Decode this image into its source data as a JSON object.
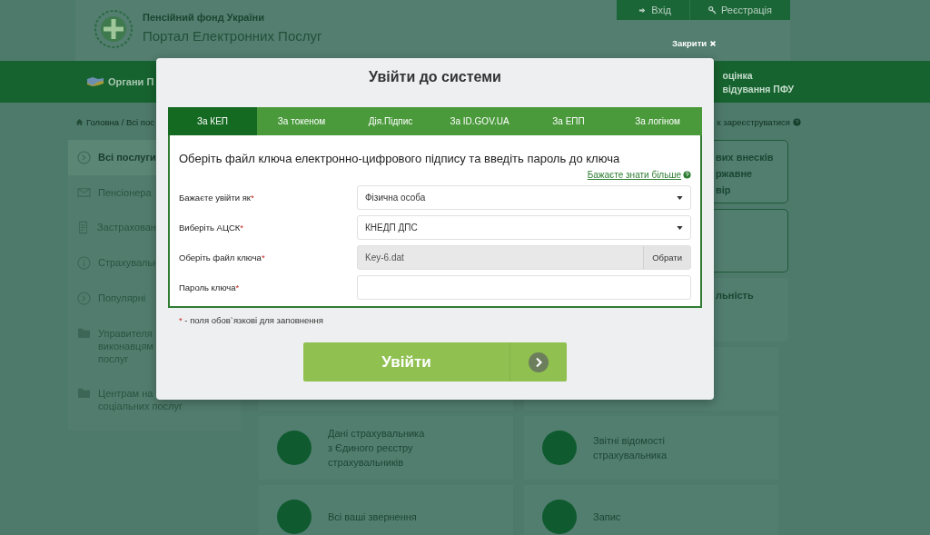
{
  "header": {
    "org": "Пенсійний фонд України",
    "title": "Портал Електронних Послуг",
    "login": "Вхід",
    "register": "Реєстрація",
    "close": "Закрити"
  },
  "nav": {
    "left": "Органи П",
    "right_lines": [
      "оцінка",
      "відування ПФУ"
    ]
  },
  "breadcrumb": {
    "home": "Головна / Всі пос",
    "help": "к зареєструватися"
  },
  "sidebar": {
    "items": [
      {
        "lines": [
          "Всі послуги"
        ],
        "selected": true
      },
      {
        "lines": [
          "Пенсіонера"
        ],
        "selected": false
      },
      {
        "lines": [
          "Застрахован"
        ],
        "selected": false
      },
      {
        "lines": [
          "Страхувальн"
        ],
        "selected": false
      },
      {
        "lines": [
          "Популярні"
        ],
        "selected": false
      },
      {
        "lines": [
          "Управителя",
          "виконавцям",
          "послуг"
        ],
        "selected": false
      },
      {
        "lines": [
          "Центрам на",
          "соціальних послуг"
        ],
        "selected": false
      }
    ]
  },
  "top_cards": [
    {
      "lines": [
        "вих внесків",
        "ржавне",
        "вір"
      ],
      "highlighted": true
    },
    {
      "highlighted": true
    },
    {
      "lines": [
        "льність"
      ],
      "highlighted": false
    }
  ],
  "bottom_cards": [
    {
      "lines": [
        "Дані страхувальника",
        "з Єдиного реєстру",
        "страхувальників"
      ]
    },
    {
      "lines": [
        "Звітні відомості",
        "страхувальника"
      ]
    },
    {
      "lines": [
        "Всі ваші звернення"
      ]
    },
    {
      "lines": [
        "Запис"
      ]
    }
  ],
  "modal": {
    "title": "Увійти до системи",
    "tabs": [
      {
        "label": "За КЕП",
        "selected": true
      },
      {
        "label": "За токеном",
        "selected": false
      },
      {
        "label": "Дія.Підпис",
        "selected": false
      },
      {
        "label": "За ID.GOV.UA",
        "selected": false
      },
      {
        "label": "За ЕПП",
        "selected": false
      },
      {
        "label": "За логіном",
        "selected": false
      }
    ],
    "heading": "Оберіть файл ключа електронно-цифрового підпису та введіть пароль до ключа",
    "help_link": "Бажаєте знати більше",
    "fields": [
      {
        "kind": "select",
        "label": "Бажаєте увійти як",
        "mark": "*",
        "value": "Фізична особа"
      },
      {
        "kind": "select",
        "label": "Виберіть АЦСК",
        "mark": "*",
        "value": "КНЕДП ДПС"
      },
      {
        "kind": "file",
        "label": "Оберіть файл ключа",
        "mark": "*",
        "value": "Key-6.dat",
        "button": "Обрати"
      },
      {
        "kind": "password",
        "label": "Пароль ключа",
        "mark": "*"
      }
    ],
    "note": {
      "mark": "*",
      "text": "- поля обов`язкові для заповнення"
    },
    "submit": "Увійти"
  }
}
